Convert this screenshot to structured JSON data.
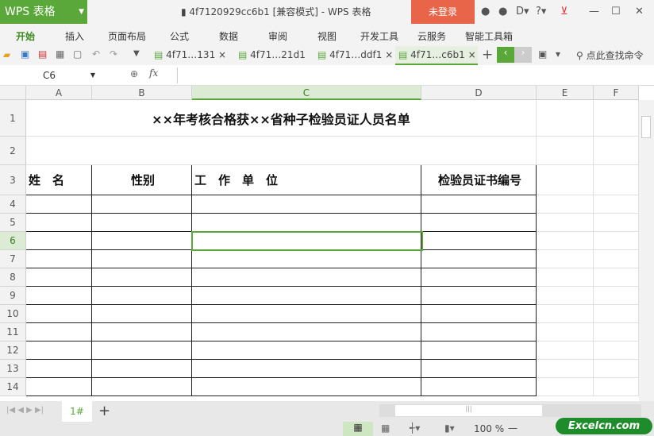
{
  "app": {
    "name": "WPS 表格",
    "window_title": "4f7120929cc6b1 [兼容模式] - WPS 表格",
    "login": "未登录"
  },
  "menu": [
    "开始",
    "插入",
    "页面布局",
    "公式",
    "数据",
    "审阅",
    "视图",
    "开发工具",
    "云服务",
    "智能工具箱"
  ],
  "doc_tabs": [
    {
      "label": "4f71…131"
    },
    {
      "label": "4f71…21d1"
    },
    {
      "label": "4f71…ddf1"
    },
    {
      "label": "4f71…c6b1",
      "active": true
    }
  ],
  "search_command": "点此查找命令",
  "formula_bar": {
    "name_box": "C6",
    "fx": "fx",
    "value": ""
  },
  "columns": [
    "A",
    "B",
    "C",
    "D",
    "E",
    "F"
  ],
  "rows": [
    "1",
    "2",
    "3",
    "4",
    "5",
    "6",
    "7",
    "8",
    "9",
    "10",
    "11",
    "12",
    "13",
    "14"
  ],
  "sheet": {
    "title": "××年考核合格获××省种子检验员证人员名单",
    "headers": [
      "姓　名",
      "性别",
      "工　作　单　位",
      "检验员证书编号"
    ]
  },
  "sheet_tabs": [
    "1#"
  ],
  "zoom": "100 %",
  "watermark": "Excelcn.com",
  "accent": "#5aa83a"
}
